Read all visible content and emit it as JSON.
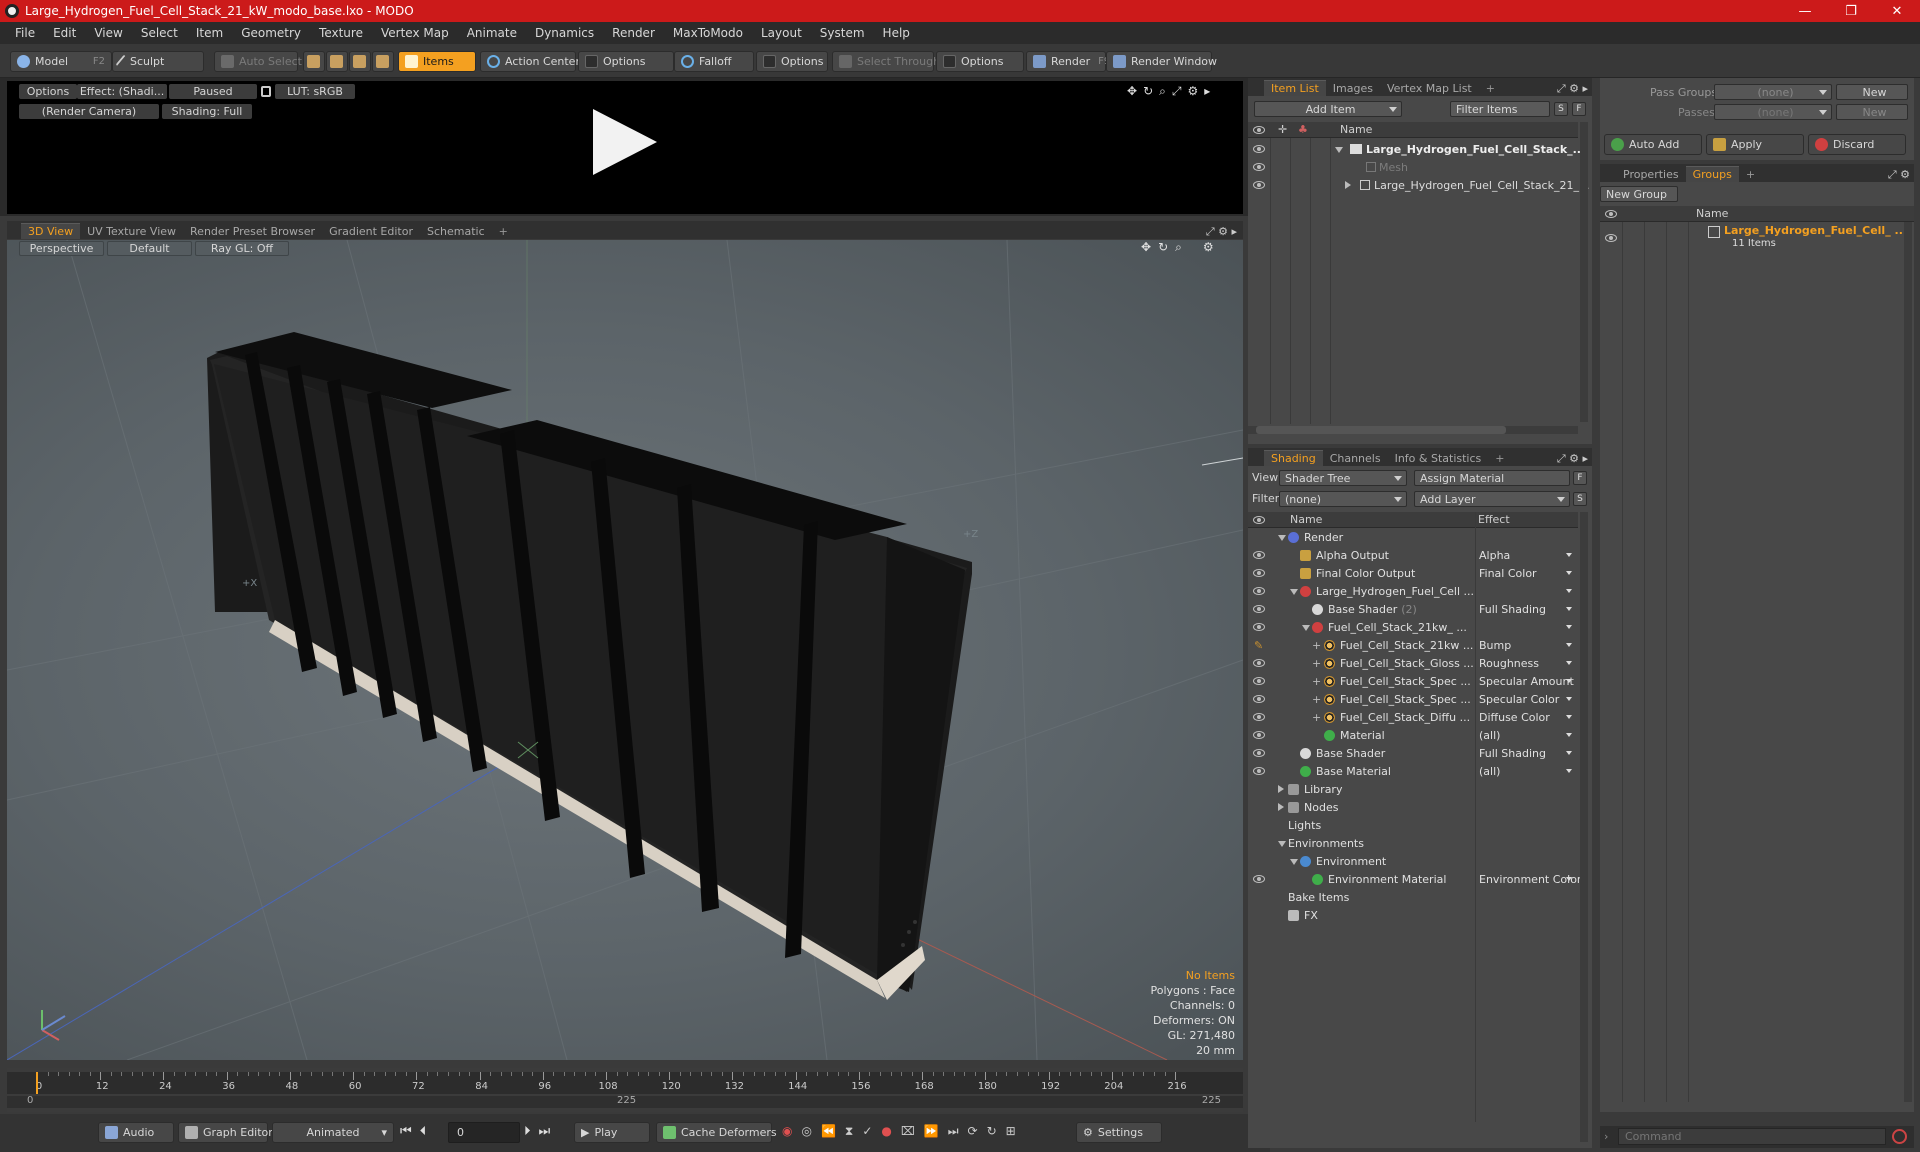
{
  "window": {
    "title": "Large_Hydrogen_Fuel_Cell_Stack_21_kW_modo_base.lxo - MODO",
    "controls": [
      "—",
      "❐",
      "✕"
    ]
  },
  "menu": [
    "File",
    "Edit",
    "View",
    "Select",
    "Item",
    "Geometry",
    "Texture",
    "Vertex Map",
    "Animate",
    "Dynamics",
    "Render",
    "MaxToModo",
    "Layout",
    "System",
    "Help"
  ],
  "toolbar": {
    "model": "Model",
    "model_key": "F2",
    "sculpt": "Sculpt",
    "auto_select": "Auto Select",
    "items": "Items",
    "action_center": "Action Center",
    "options1": "Options",
    "falloff": "Falloff",
    "options2": "Options",
    "select_through": "Select Through",
    "options3": "Options",
    "render": "Render",
    "render_key": "F9",
    "render_window": "Render Window"
  },
  "preview": {
    "options": "Options",
    "effect": "Effect: (Shadi...",
    "paused": "Paused",
    "lut": "LUT: sRGB",
    "camera": "(Render Camera)",
    "shading": "Shading: Full"
  },
  "viewtabs": [
    "3D View",
    "UV Texture View",
    "Render Preset Browser",
    "Gradient Editor",
    "Schematic",
    "+"
  ],
  "viewport": {
    "perspective": "Perspective",
    "default": "Default",
    "raygl": "Ray GL: Off",
    "axis_x": "+X",
    "axis_z": "+Z",
    "stats": {
      "no_items": "No Items",
      "polygons": "Polygons : Face",
      "channels": "Channels: 0",
      "deformers": "Deformers: ON",
      "gl": "GL: 271,480",
      "unit": "20 mm"
    }
  },
  "timeline": {
    "ticks": [
      "0",
      "12",
      "24",
      "36",
      "48",
      "60",
      "72",
      "84",
      "96",
      "108",
      "120",
      "132",
      "144",
      "156",
      "168",
      "180",
      "192",
      "204",
      "216"
    ],
    "range_start": "0",
    "range_mid": "225",
    "range_end": "225"
  },
  "bottombar": {
    "audio": "Audio",
    "graph_editor": "Graph Editor",
    "animated": "Animated",
    "frame": "0",
    "play": "Play",
    "cache": "Cache Deformers",
    "settings": "Settings"
  },
  "itemlist": {
    "tabs": [
      "Item List",
      "Images",
      "Vertex Map List",
      "+"
    ],
    "add_item": "Add Item",
    "filter": "Filter Items",
    "s": "S",
    "f": "F",
    "col_name": "Name",
    "items": [
      {
        "label": "Large_Hydrogen_Fuel_Cell_Stack_...",
        "bold": true
      },
      {
        "label": "Mesh",
        "dim": true
      },
      {
        "label": "Large_Hydrogen_Fuel_Cell_Stack_21_..."
      }
    ]
  },
  "shading": {
    "tabs": [
      "Shading",
      "Channels",
      "Info & Statistics",
      "+"
    ],
    "view_label": "View",
    "view_value": "Shader Tree",
    "assign_material": "Assign Material",
    "filter_label": "Filter",
    "filter_value": "(none)",
    "add_layer": "Add Layer",
    "col_name": "Name",
    "col_effect": "Effect",
    "rows": [
      {
        "name": "Render",
        "effect": "",
        "icon": "render",
        "color": "#5a6fd6"
      },
      {
        "name": "Alpha Output",
        "effect": "Alpha",
        "icon": "output",
        "color": "#c9a040"
      },
      {
        "name": "Final Color Output",
        "effect": "Final Color",
        "icon": "output",
        "color": "#c9a040"
      },
      {
        "name": "Large_Hydrogen_Fuel_Cell ...",
        "effect": "",
        "icon": "mask",
        "color": "#d04040"
      },
      {
        "name": "Base Shader",
        "suffix": "(2)",
        "effect": "Full Shading",
        "icon": "shader",
        "color": "#d8d8d8"
      },
      {
        "name": "Fuel_Cell_Stack_21kw_ ...",
        "effect": "",
        "icon": "mask",
        "color": "#d04040"
      },
      {
        "name": "Fuel_Cell_Stack_21kw ...",
        "effect": "Bump",
        "icon": "texture",
        "color": "#c89030"
      },
      {
        "name": "Fuel_Cell_Stack_Gloss ...",
        "effect": "Roughness",
        "icon": "texture",
        "color": "#c89030"
      },
      {
        "name": "Fuel_Cell_Stack_Spec ...",
        "effect": "Specular Amount",
        "icon": "texture",
        "color": "#c89030"
      },
      {
        "name": "Fuel_Cell_Stack_Spec ...",
        "effect": "Specular Color",
        "icon": "texture",
        "color": "#c89030"
      },
      {
        "name": "Fuel_Cell_Stack_Diffu ...",
        "effect": "Diffuse Color",
        "icon": "texture",
        "color": "#c89030"
      },
      {
        "name": "Material",
        "effect": "(all)",
        "icon": "material",
        "color": "#3fae4a"
      },
      {
        "name": "Base Shader",
        "effect": "Full Shading",
        "icon": "shader",
        "color": "#d8d8d8"
      },
      {
        "name": "Base Material",
        "effect": "(all)",
        "icon": "material",
        "color": "#3fae4a"
      },
      {
        "name": "Library",
        "effect": "",
        "icon": "folder",
        "color": "#999"
      },
      {
        "name": "Nodes",
        "effect": "",
        "icon": "folder",
        "color": "#999"
      },
      {
        "name": "Lights",
        "effect": "",
        "icon": "none",
        "color": "#999"
      },
      {
        "name": "Environments",
        "effect": "",
        "icon": "none",
        "color": "#999"
      },
      {
        "name": "Environment",
        "effect": "",
        "icon": "env",
        "color": "#4a8ad0"
      },
      {
        "name": "Environment Material",
        "effect": "Environment Color",
        "icon": "material",
        "color": "#3fae4a"
      },
      {
        "name": "Bake Items",
        "effect": "",
        "icon": "none",
        "color": "#999"
      },
      {
        "name": "FX",
        "effect": "",
        "icon": "fx",
        "color": "#bbb"
      }
    ]
  },
  "groups": {
    "pass_groups_label": "Pass Groups",
    "pass_groups_value": "(none)",
    "passes_label": "Passes",
    "passes_value": "(none)",
    "new": "New",
    "new2": "New",
    "auto_add": "Auto Add",
    "apply": "Apply",
    "discard": "Discard",
    "tabs": [
      "Properties",
      "Groups",
      "+"
    ],
    "new_group": "New Group",
    "col_name": "Name",
    "group_name": "Large_Hydrogen_Fuel_Cell_ ...",
    "group_count": "11 Items",
    "command_placeholder": "Command"
  },
  "colors": {
    "titlebar": "#cc1a1a",
    "accent": "#f4a020",
    "panel": "#484848",
    "viewport_bg": "#5e666b"
  }
}
